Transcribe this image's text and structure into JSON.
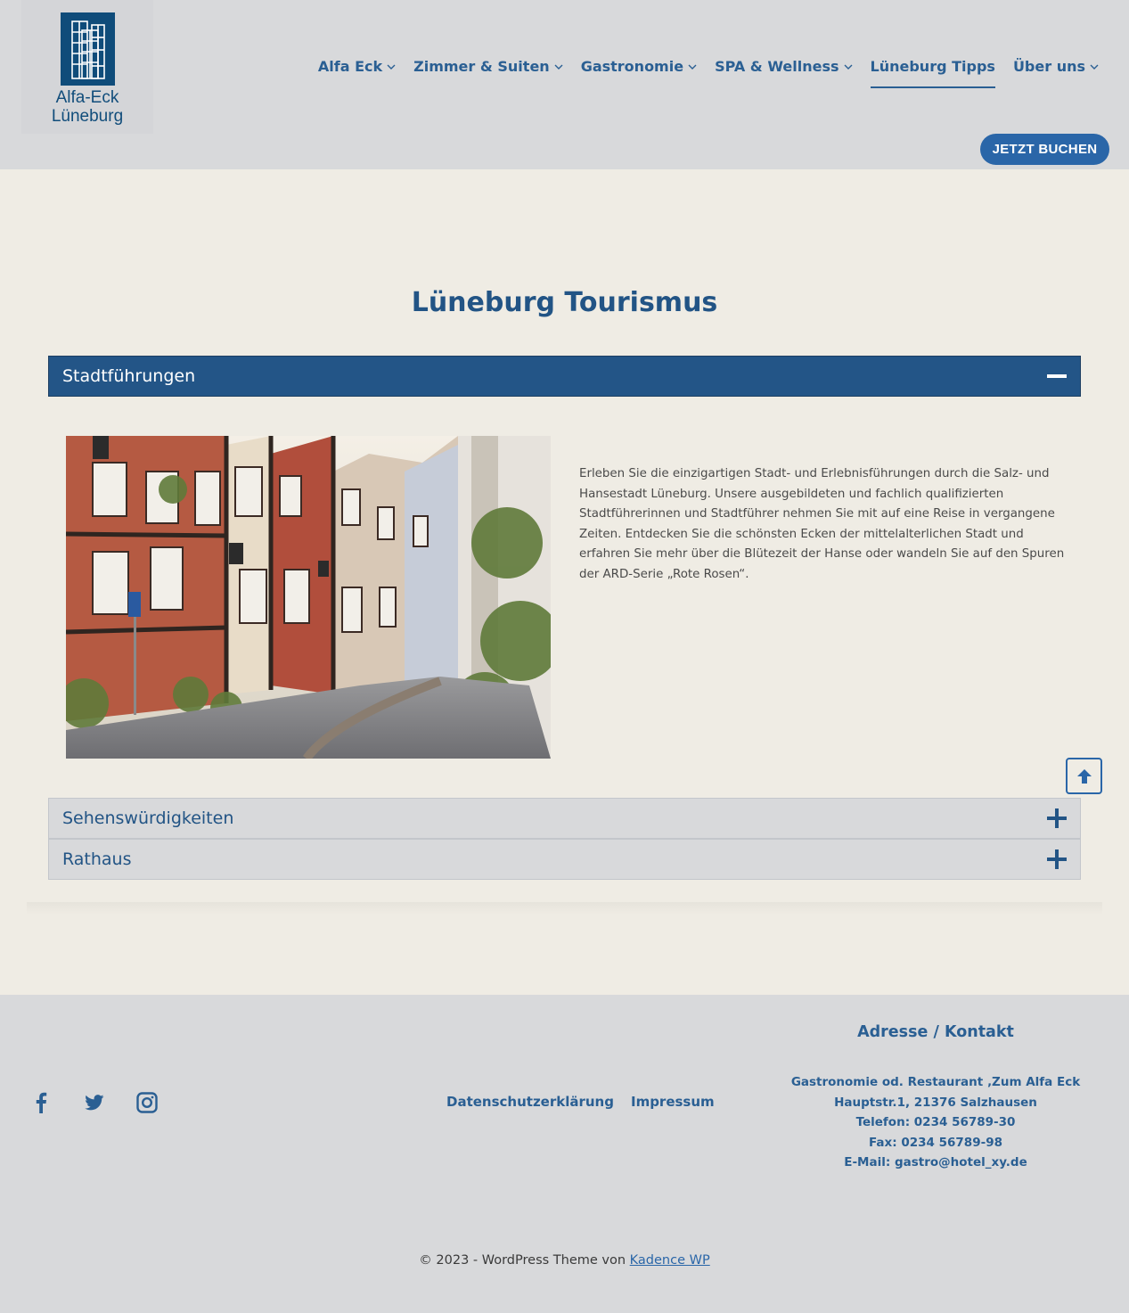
{
  "header": {
    "logo": {
      "line1": "Alfa-Eck",
      "line2": "Lüneburg"
    },
    "nav": [
      {
        "label": "Alfa Eck",
        "has_submenu": true
      },
      {
        "label": "Zimmer & Suiten",
        "has_submenu": true
      },
      {
        "label": "Gastronomie",
        "has_submenu": true
      },
      {
        "label": "SPA & Wellness",
        "has_submenu": true
      },
      {
        "label": "Lüneburg Tipps",
        "has_submenu": false,
        "active": true
      },
      {
        "label": "Über uns",
        "has_submenu": true
      }
    ],
    "book_button": "JETZT BUCHEN"
  },
  "main": {
    "title": "Lüneburg Tourismus",
    "accordion": [
      {
        "label": "Stadtführungen",
        "open": true,
        "text": "Erleben Sie die einzigartigen Stadt- und Erlebnisführungen durch die Salz- und Hansestadt Lüneburg. Unsere ausgebildeten und fachlich qualifizierten Stadtführerinnen und Stadtführer nehmen Sie mit auf eine Reise in vergangene Zeiten. Entdecken Sie die schönsten Ecken der mittelalterlichen Stadt und erfahren Sie mehr über die Blütezeit der Hanse oder wandeln Sie auf den Spuren der ARD-Serie „Rote Rosen“."
      },
      {
        "label": "Sehenswürdigkeiten",
        "open": false
      },
      {
        "label": "Rathaus",
        "open": false
      }
    ]
  },
  "footer": {
    "social": [
      "facebook-icon",
      "twitter-icon",
      "instagram-icon"
    ],
    "links": [
      "Datenschutzerklärung",
      "Impressum"
    ],
    "contact": {
      "title": "Adresse / Kontakt",
      "lines": [
        "Gastronomie od. Restaurant ‚Zum Alfa Eck",
        "Hauptstr.1, 21376 Salzhausen",
        "Telefon: 0234 56789-30",
        "Fax: 0234 56789-98",
        "E-Mail: gastro@hotel_xy.de"
      ]
    },
    "copyright_prefix": "© 2023 - WordPress Theme von ",
    "copyright_link": "Kadence WP"
  },
  "colors": {
    "brand": "#235587",
    "accent": "#2a66a8",
    "header_bg": "#d8d9db",
    "page_bg": "#efece4"
  }
}
